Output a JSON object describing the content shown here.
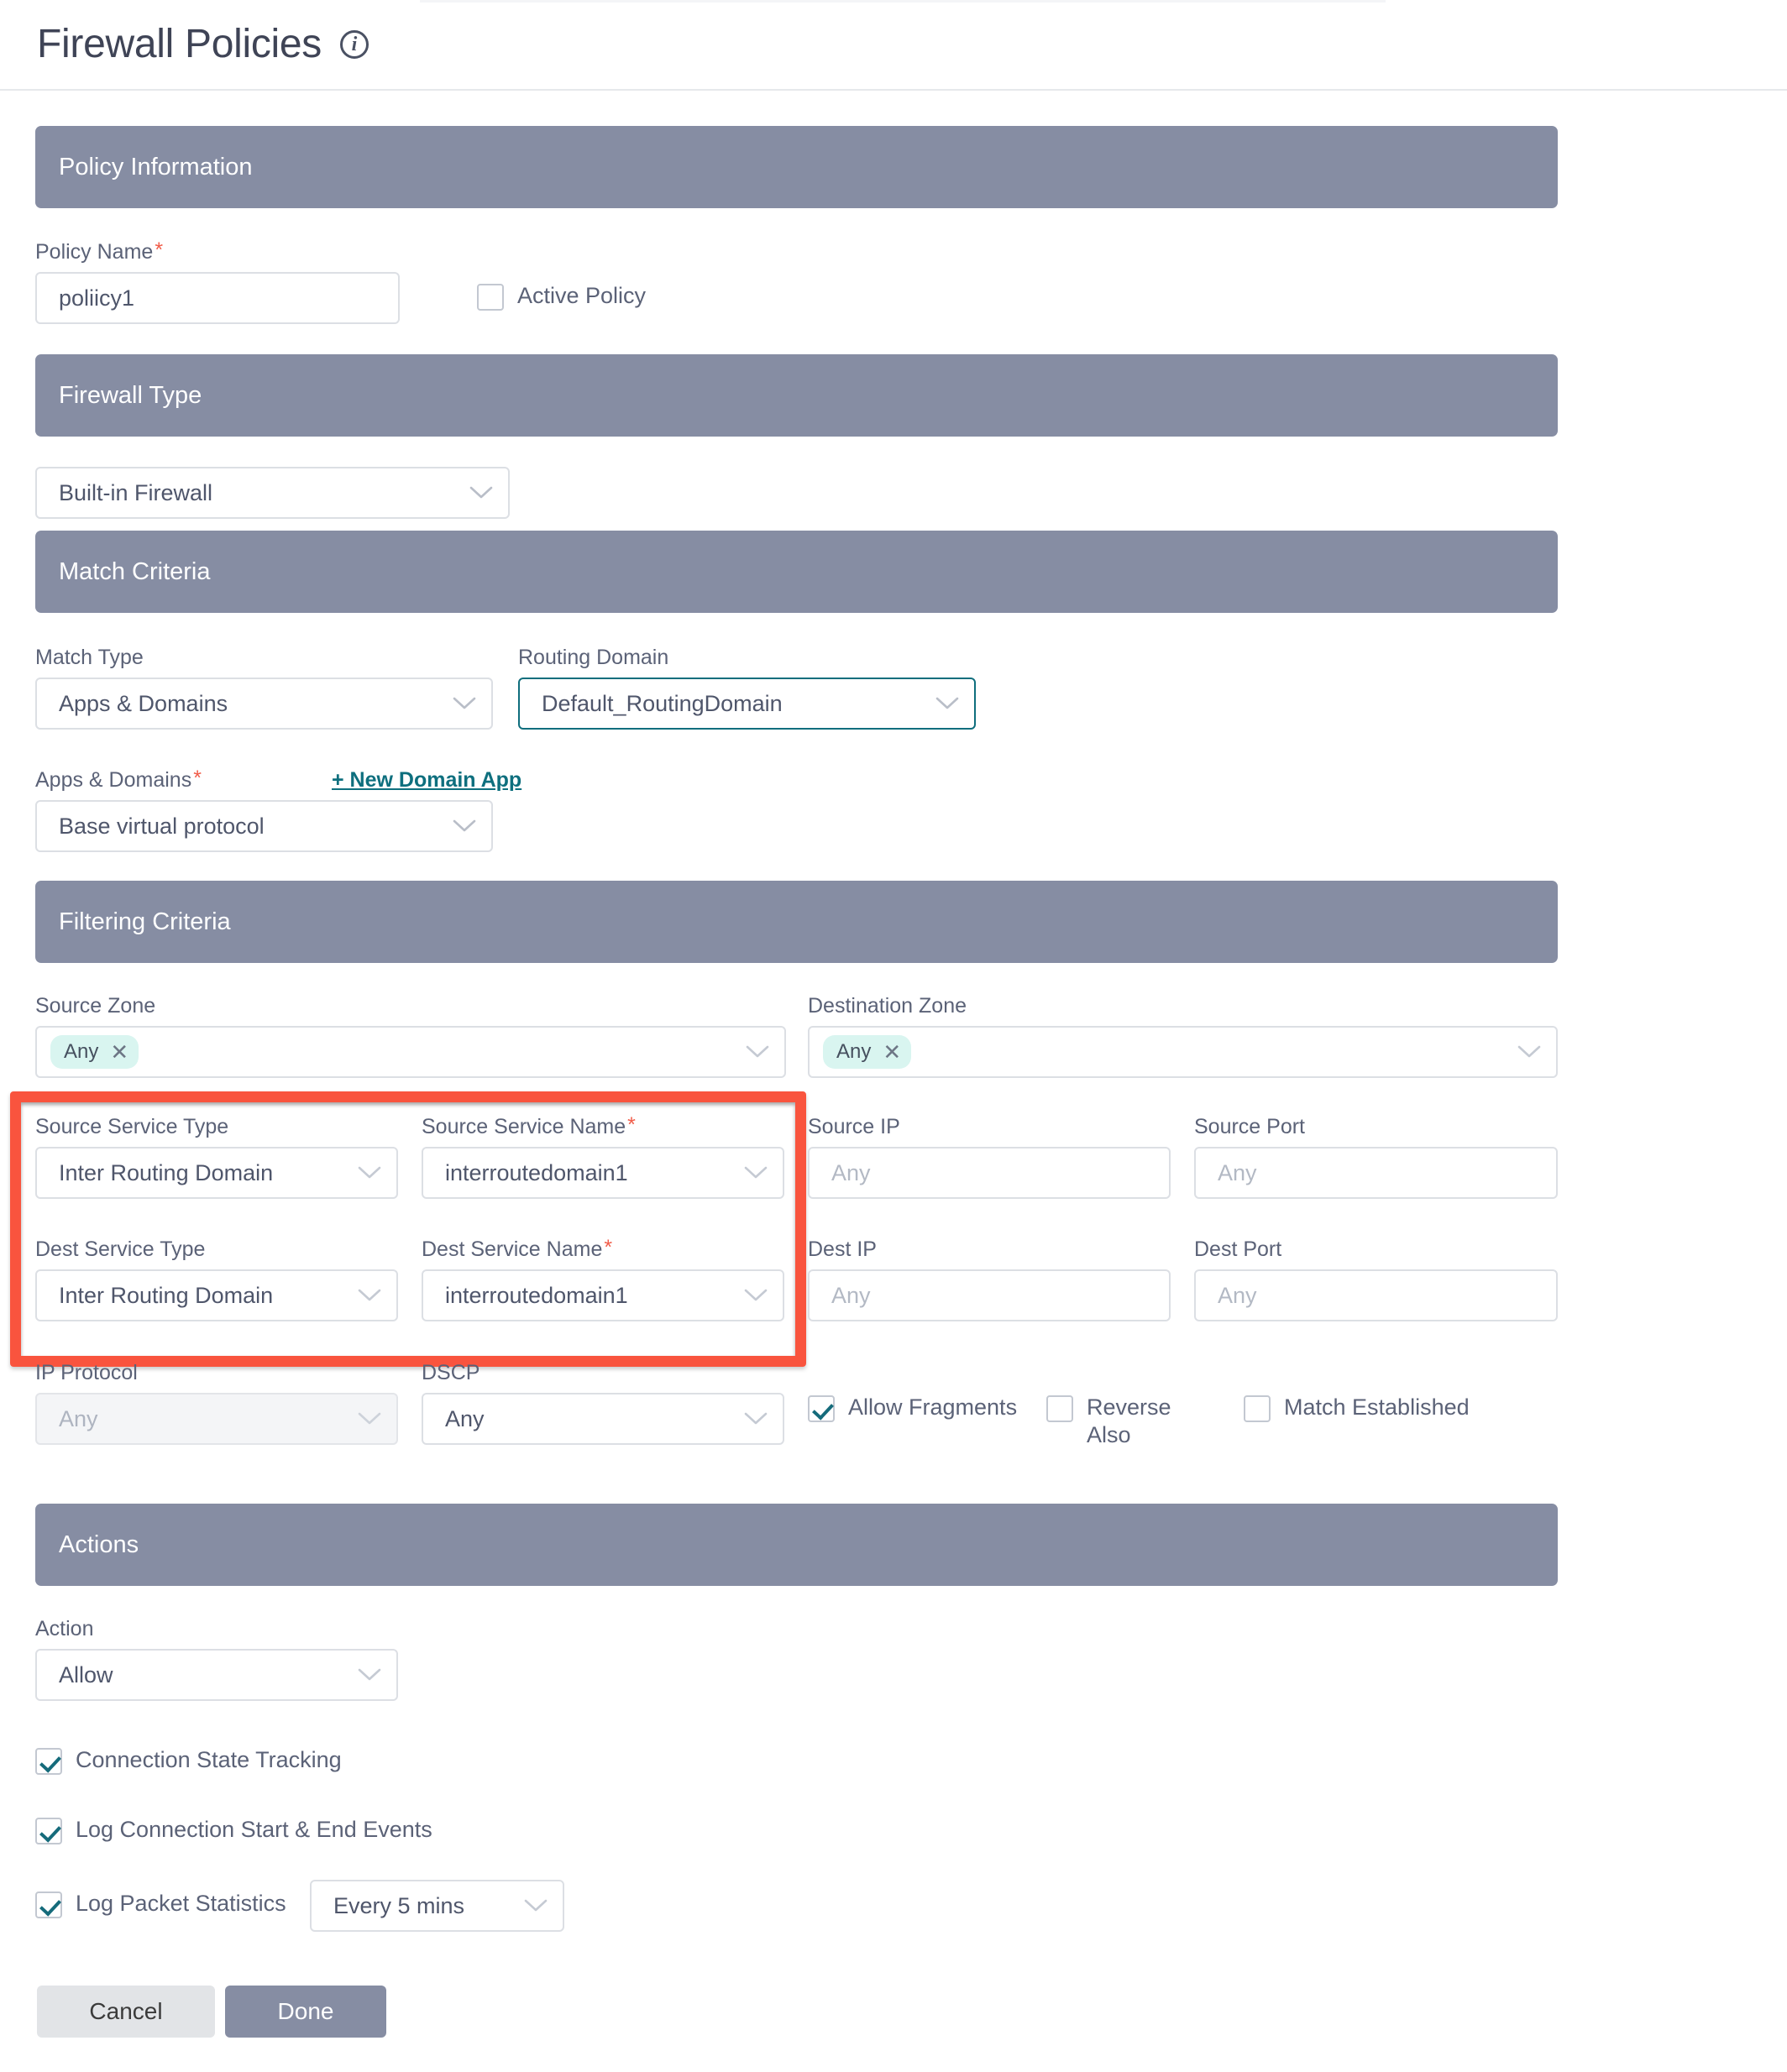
{
  "header": {
    "title": "Firewall Policies",
    "info_icon": "info-circle-icon"
  },
  "sections": {
    "policy_information": "Policy Information",
    "firewall_type": "Firewall Type",
    "match_criteria": "Match Criteria",
    "filtering_criteria": "Filtering Criteria",
    "actions": "Actions"
  },
  "policy_information": {
    "policy_name_label": "Policy Name",
    "policy_name_value": "poliicy1",
    "active_policy_label": "Active Policy",
    "active_policy_checked": false
  },
  "firewall_type": {
    "value": "Built-in Firewall"
  },
  "match_criteria": {
    "match_type_label": "Match Type",
    "match_type_value": "Apps & Domains",
    "routing_domain_label": "Routing Domain",
    "routing_domain_value": "Default_RoutingDomain",
    "apps_domains_label": "Apps & Domains",
    "new_domain_app_link": "+ New Domain App",
    "apps_domains_value": "Base virtual protocol"
  },
  "filtering_criteria": {
    "source_zone_label": "Source Zone",
    "source_zone_chip": "Any",
    "destination_zone_label": "Destination Zone",
    "destination_zone_chip": "Any",
    "source_service_type_label": "Source Service Type",
    "source_service_type_value": "Inter Routing Domain",
    "source_service_name_label": "Source Service Name",
    "source_service_name_value": "interroutedomain1",
    "dest_service_type_label": "Dest Service Type",
    "dest_service_type_value": "Inter Routing Domain",
    "dest_service_name_label": "Dest Service Name",
    "dest_service_name_value": "interroutedomain1",
    "source_ip_label": "Source IP",
    "source_ip_placeholder": "Any",
    "source_port_label": "Source Port",
    "source_port_placeholder": "Any",
    "dest_ip_label": "Dest IP",
    "dest_ip_placeholder": "Any",
    "dest_port_label": "Dest Port",
    "dest_port_placeholder": "Any",
    "ip_protocol_label": "IP Protocol",
    "ip_protocol_value": "Any",
    "dscp_label": "DSCP",
    "dscp_value": "Any",
    "allow_fragments_label": "Allow Fragments",
    "allow_fragments_checked": true,
    "reverse_also_label": "Reverse Also",
    "reverse_also_checked": false,
    "match_established_label": "Match Established",
    "match_established_checked": false
  },
  "actions": {
    "action_label": "Action",
    "action_value": "Allow",
    "connection_state_tracking_label": "Connection State Tracking",
    "connection_state_tracking_checked": true,
    "log_connection_events_label": "Log Connection Start & End Events",
    "log_connection_events_checked": true,
    "log_packet_statistics_label": "Log Packet Statistics",
    "log_packet_statistics_checked": true,
    "log_packet_interval_value": "Every 5 mins"
  },
  "footer": {
    "cancel_label": "Cancel",
    "done_label": "Done"
  },
  "colors": {
    "section_header_bg": "#868da3",
    "accent_teal": "#0f6e7d",
    "chip_bg": "#d9f5f0",
    "required_red": "#f15d4a",
    "highlight_red": "#f9543e",
    "link_teal": "#0e6f7e"
  }
}
